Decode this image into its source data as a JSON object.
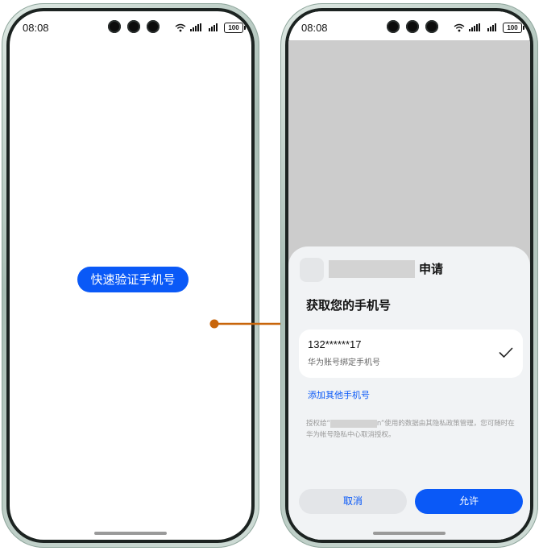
{
  "colors": {
    "accent": "#0a59f7",
    "connector_arrow": "#c8650a",
    "dim_overlay": "#cccccc",
    "sheet_background": "#f1f3f5"
  },
  "left_phone": {
    "status_bar": {
      "time": "08:08",
      "battery": "100"
    },
    "verify_button_label": "快速验证手机号"
  },
  "right_phone": {
    "status_bar": {
      "time": "08:08",
      "battery": "100"
    },
    "sheet": {
      "request_label": "申请",
      "title": "获取您的手机号",
      "phone_option": {
        "number": "132******17",
        "description": "华为账号绑定手机号",
        "selected": true,
        "check_icon": "checkmark-icon"
      },
      "add_phone_link": "添加其他手机号",
      "auth_text_prefix": "授权给“",
      "auth_text_middle": "n”使用的数据由其隐私政策管理，您可随时在华为帐号隐私中心取消授权。",
      "cancel_label": "取消",
      "allow_label": "允许"
    }
  }
}
